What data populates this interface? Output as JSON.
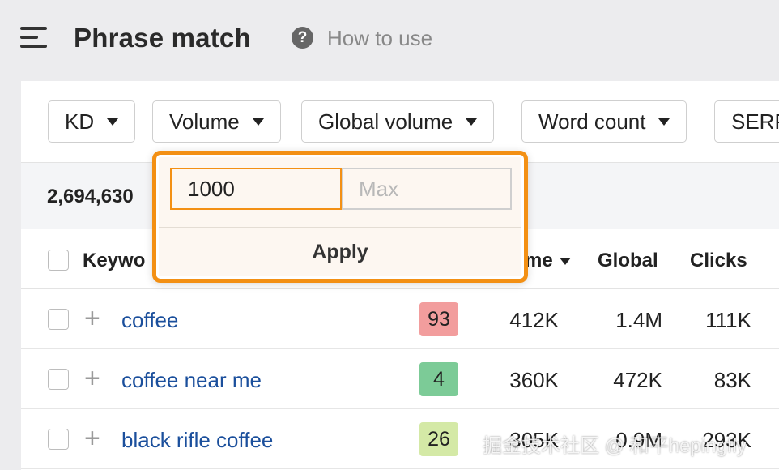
{
  "header": {
    "title": "Phrase match",
    "help_label": "How to use"
  },
  "filters": [
    {
      "label": "KD"
    },
    {
      "label": "Volume"
    },
    {
      "label": "Global volume"
    },
    {
      "label": "Word count"
    },
    {
      "label": "SERP"
    }
  ],
  "summary": {
    "count": "2,694,630"
  },
  "table": {
    "columns": {
      "keyword": "Keywo",
      "volume": "me",
      "global": "Global",
      "clicks": "Clicks"
    },
    "rows": [
      {
        "keyword": "coffee",
        "kd": "93",
        "kd_color": "#f29d9d",
        "volume": "412K",
        "global": "1.4M",
        "clicks": "111K"
      },
      {
        "keyword": "coffee near me",
        "kd": "4",
        "kd_color": "#7ccb97",
        "volume": "360K",
        "global": "472K",
        "clicks": "83K"
      },
      {
        "keyword": "black rifle coffee",
        "kd": "26",
        "kd_color": "#d4e9a6",
        "volume": "305K",
        "global": "0.9M",
        "clicks": "293K"
      }
    ]
  },
  "volume_popup": {
    "min_value": "1000",
    "max_placeholder": "Max",
    "apply_label": "Apply"
  },
  "colors": {
    "accent": "#f39014",
    "link": "#1b4f9c"
  },
  "watermark": "掘金技术社区 @ 和平hepingfly"
}
